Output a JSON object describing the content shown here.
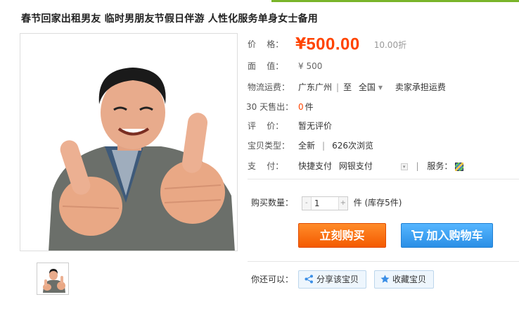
{
  "product": {
    "title": "春节回家出租男友 临时男朋友节假日伴游 人性化服务单身女士备用"
  },
  "price": {
    "label": "价　　格：",
    "label_chars": [
      "价",
      "格："
    ],
    "currency": "¥",
    "value": "500.00",
    "discount": "10.00折"
  },
  "face_value": {
    "label_chars": [
      "面",
      "值："
    ],
    "value": "¥ 500"
  },
  "shipping": {
    "label": "物流运费：",
    "from": "广东广州",
    "to_prefix": "至",
    "to": "全国",
    "note": "卖家承担运费"
  },
  "sales": {
    "label": "30 天售出：",
    "count": "0",
    "unit": "件"
  },
  "review": {
    "label_chars": [
      "评",
      "价："
    ],
    "value": "暂无评价"
  },
  "item_type": {
    "label": "宝贝类型：",
    "condition": "全新",
    "views": "626次浏览"
  },
  "payment": {
    "label_chars": [
      "支",
      "付："
    ],
    "methods": [
      "快捷支付",
      "网银支付"
    ],
    "service_label": "服务："
  },
  "quantity": {
    "label": "购买数量：",
    "minus": "-",
    "value": "1",
    "plus": "+",
    "unit_stock": "件 (库存5件)"
  },
  "actions": {
    "buy_now": "立刻购买",
    "add_to_cart": "加入购物车"
  },
  "more": {
    "label": "你还可以：",
    "share": "分享该宝贝",
    "favorite": "收藏宝贝"
  },
  "colors": {
    "price": "#ff4400",
    "buy_button": "#f45a00",
    "cart_button": "#2a8fe6",
    "top_bar": "#7ab52a"
  }
}
